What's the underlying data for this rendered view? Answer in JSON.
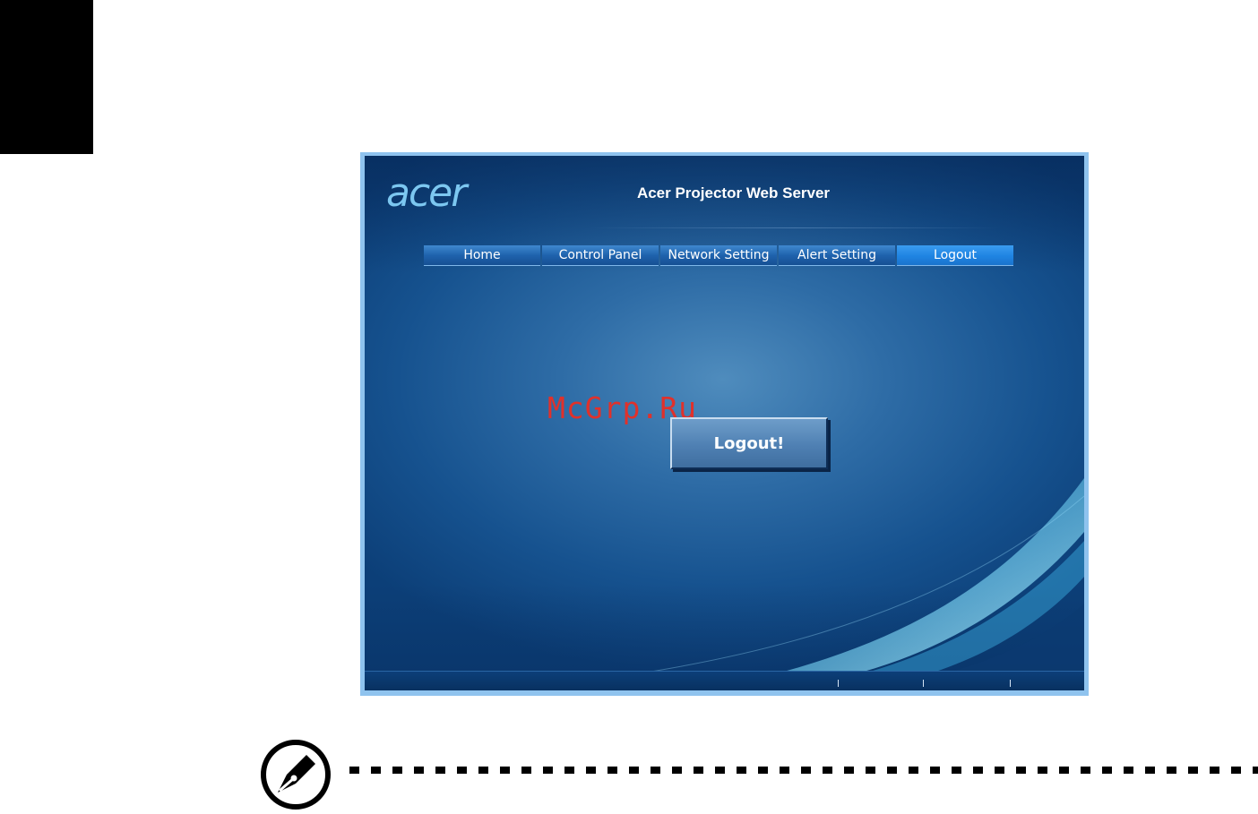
{
  "screen": {
    "logo_text": "acer",
    "title": "Acer Projector Web Server",
    "nav": [
      {
        "label": "Home",
        "active": false
      },
      {
        "label": "Control Panel",
        "active": false
      },
      {
        "label": "Network Setting",
        "active": false
      },
      {
        "label": "Alert Setting",
        "active": false
      },
      {
        "label": "Logout",
        "active": true
      }
    ],
    "watermark": "McGrp.Ru",
    "logout_button": "Logout!"
  },
  "page": {
    "note_icon": "pen-nib-icon"
  },
  "colors": {
    "accent": "#1f63ad",
    "watermark": "#e0312b"
  }
}
